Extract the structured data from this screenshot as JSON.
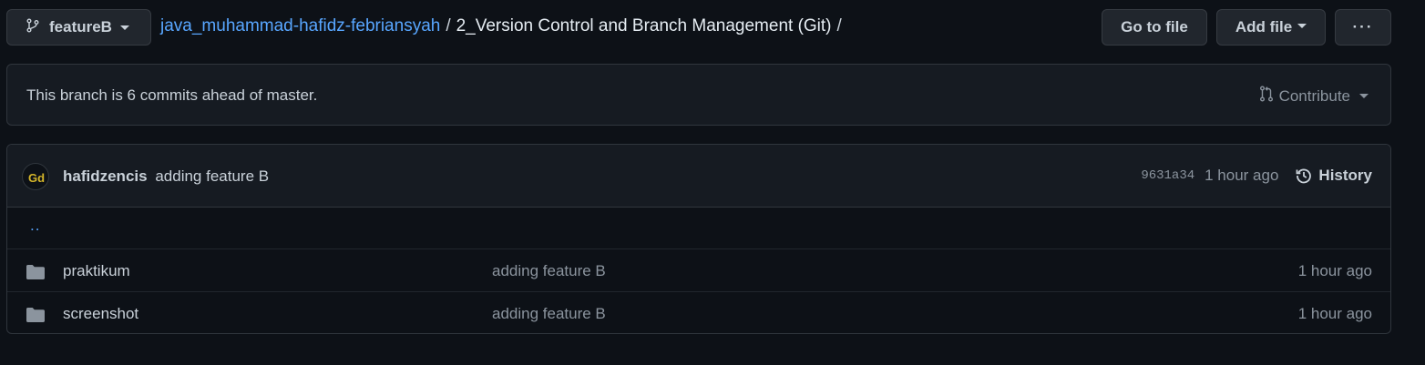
{
  "branch": {
    "name": "featureB",
    "icon": "git-branch-icon"
  },
  "breadcrumb": {
    "repo": "java_muhammad-hafidz-febriansyah",
    "separator": "/",
    "folder": "2_Version Control and Branch Management (Git)",
    "trailing": "/"
  },
  "actions": {
    "goto_label": "Go to file",
    "addfile_label": "Add file",
    "more_label": "···"
  },
  "banner": {
    "message": "This branch is 6 commits ahead of master.",
    "contribute_label": "Contribute"
  },
  "latest_commit": {
    "author": "hafidzencis",
    "message": "adding feature B",
    "sha": "9631a34",
    "time": "1 hour ago",
    "history_label": "History"
  },
  "parent_dir": "..",
  "files": [
    {
      "name": "praktikum",
      "commit_message": "adding feature B",
      "age": "1 hour ago",
      "icon": "folder-icon"
    },
    {
      "name": "screenshot",
      "commit_message": "adding feature B",
      "age": "1 hour ago",
      "icon": "folder-icon"
    }
  ],
  "colors": {
    "background": "#0d1117",
    "link": "#58a6ff",
    "muted": "#8b949e",
    "border": "#30363d",
    "button": "#21262d"
  }
}
